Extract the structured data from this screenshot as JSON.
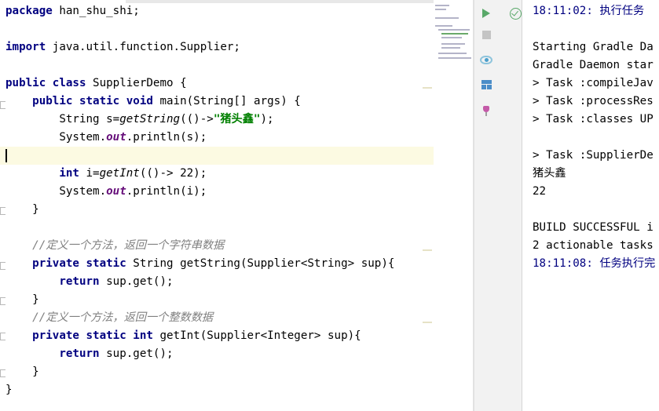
{
  "editor": {
    "lines": [
      {
        "tokens": [
          {
            "t": "kw",
            "v": "package"
          },
          {
            "t": "n",
            "v": " han_shu_shi;"
          }
        ]
      },
      {
        "tokens": []
      },
      {
        "tokens": [
          {
            "t": "kw",
            "v": "import"
          },
          {
            "t": "n",
            "v": " java.util.function.Supplier;"
          }
        ]
      },
      {
        "tokens": []
      },
      {
        "tokens": [
          {
            "t": "kw",
            "v": "public class"
          },
          {
            "t": "n",
            "v": " SupplierDemo {"
          }
        ]
      },
      {
        "tokens": [
          {
            "t": "n",
            "v": "    "
          },
          {
            "t": "kw",
            "v": "public static void"
          },
          {
            "t": "n",
            "v": " main(String[] args) {"
          }
        ]
      },
      {
        "tokens": [
          {
            "t": "n",
            "v": "        String s="
          },
          {
            "t": "it",
            "v": "getString"
          },
          {
            "t": "n",
            "v": "(()->"
          },
          {
            "t": "str",
            "v": "\"猪头鑫\""
          },
          {
            "t": "n",
            "v": ");"
          }
        ]
      },
      {
        "tokens": [
          {
            "t": "n",
            "v": "        System."
          },
          {
            "t": "fld",
            "v": "out"
          },
          {
            "t": "n",
            "v": ".println(s);"
          }
        ]
      },
      {
        "tokens": [],
        "current": true
      },
      {
        "tokens": [
          {
            "t": "n",
            "v": "        "
          },
          {
            "t": "kw",
            "v": "int"
          },
          {
            "t": "n",
            "v": " i="
          },
          {
            "t": "it",
            "v": "getInt"
          },
          {
            "t": "n",
            "v": "(()-> 22);"
          }
        ]
      },
      {
        "tokens": [
          {
            "t": "n",
            "v": "        System."
          },
          {
            "t": "fld",
            "v": "out"
          },
          {
            "t": "n",
            "v": ".println(i);"
          }
        ]
      },
      {
        "tokens": [
          {
            "t": "n",
            "v": "    }"
          }
        ]
      },
      {
        "tokens": []
      },
      {
        "tokens": [
          {
            "t": "n",
            "v": "    "
          },
          {
            "t": "cmt",
            "v": "//定义一个方法，返回一个字符串数据"
          }
        ]
      },
      {
        "tokens": [
          {
            "t": "n",
            "v": "    "
          },
          {
            "t": "kw",
            "v": "private static"
          },
          {
            "t": "n",
            "v": " String getString(Supplier<String> sup){"
          }
        ]
      },
      {
        "tokens": [
          {
            "t": "n",
            "v": "        "
          },
          {
            "t": "kw",
            "v": "return"
          },
          {
            "t": "n",
            "v": " sup.get();"
          }
        ]
      },
      {
        "tokens": [
          {
            "t": "n",
            "v": "    }"
          }
        ]
      },
      {
        "tokens": [
          {
            "t": "n",
            "v": "    "
          },
          {
            "t": "cmt",
            "v": "//定义一个方法，返回一个整数数据"
          }
        ]
      },
      {
        "tokens": [
          {
            "t": "n",
            "v": "    "
          },
          {
            "t": "kw",
            "v": "private static int"
          },
          {
            "t": "n",
            "v": " getInt(Supplier<Integer> sup){"
          }
        ]
      },
      {
        "tokens": [
          {
            "t": "n",
            "v": "        "
          },
          {
            "t": "kw",
            "v": "return"
          },
          {
            "t": "n",
            "v": " sup.get();"
          }
        ]
      },
      {
        "tokens": [
          {
            "t": "n",
            "v": "    }"
          }
        ]
      },
      {
        "tokens": [
          {
            "t": "n",
            "v": "}"
          }
        ]
      }
    ]
  },
  "run_toolbar": {
    "icons": [
      "run-icon",
      "stop-icon",
      "eye-icon",
      "layout-icon",
      "pin-icon"
    ],
    "status_icon": "success-check-icon"
  },
  "console": {
    "lines": [
      {
        "kind": "time",
        "text": "18:11:02: 执行任务"
      },
      {
        "kind": "blank",
        "text": ""
      },
      {
        "kind": "plain",
        "text": "Starting Gradle Da"
      },
      {
        "kind": "plain",
        "text": "Gradle Daemon star"
      },
      {
        "kind": "plain",
        "text": "> Task :compileJav"
      },
      {
        "kind": "plain",
        "text": "> Task :processRes"
      },
      {
        "kind": "plain",
        "text": "> Task :classes UP"
      },
      {
        "kind": "blank",
        "text": ""
      },
      {
        "kind": "plain",
        "text": "> Task :SupplierDe"
      },
      {
        "kind": "plain",
        "text": "猪头鑫"
      },
      {
        "kind": "plain",
        "text": "22"
      },
      {
        "kind": "blank",
        "text": ""
      },
      {
        "kind": "plain",
        "text": "BUILD SUCCESSFUL i"
      },
      {
        "kind": "plain",
        "text": "2 actionable tasks"
      },
      {
        "kind": "time",
        "text": "18:11:08: 任务执行完"
      }
    ]
  },
  "colors": {
    "keyword": "#000080",
    "string": "#008000",
    "field": "#660e7a",
    "comment": "#808080",
    "current_line": "#fcfae2",
    "run_green": "#59a869"
  }
}
